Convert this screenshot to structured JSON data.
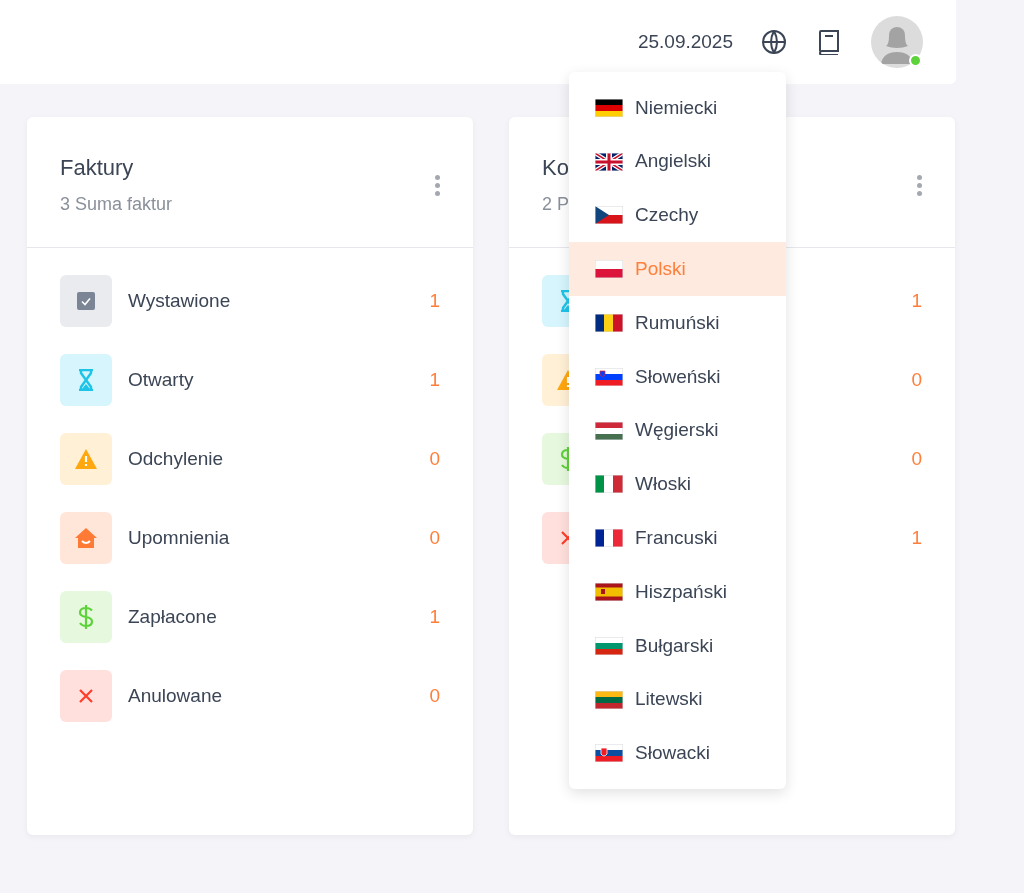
{
  "header": {
    "date": "25.09.2025",
    "user_online": true
  },
  "cards": [
    {
      "title": "Faktury",
      "subtitle": "3 Suma faktur",
      "rows": [
        {
          "kind": "issued",
          "label": "Wystawione",
          "count": "1"
        },
        {
          "kind": "open",
          "label": "Otwarty",
          "count": "1"
        },
        {
          "kind": "deviation",
          "label": "Odchylenie",
          "count": "0"
        },
        {
          "kind": "reminder",
          "label": "Upomnienia",
          "count": "0"
        },
        {
          "kind": "paid",
          "label": "Zapłacone",
          "count": "1"
        },
        {
          "kind": "cancelled",
          "label": "Anulowane",
          "count": "0"
        }
      ]
    },
    {
      "title": "Ko",
      "subtitle": "2 P",
      "rows": [
        {
          "kind": "open",
          "count": "1"
        },
        {
          "kind": "deviation",
          "count": "0"
        },
        {
          "kind": "paid",
          "count": "0"
        },
        {
          "kind": "cancelled",
          "count": "1"
        }
      ]
    }
  ],
  "language_menu": [
    {
      "kind": "de",
      "label": "Niemiecki",
      "selected": false
    },
    {
      "kind": "gb",
      "label": "Angielski",
      "selected": false
    },
    {
      "kind": "cz",
      "label": "Czechy",
      "selected": false
    },
    {
      "kind": "pl",
      "label": "Polski",
      "selected": true
    },
    {
      "kind": "ro",
      "label": "Rumuński",
      "selected": false
    },
    {
      "kind": "si",
      "label": "Słoweński",
      "selected": false
    },
    {
      "kind": "hu",
      "label": "Węgierski",
      "selected": false
    },
    {
      "kind": "it",
      "label": "Włoski",
      "selected": false
    },
    {
      "kind": "fr",
      "label": "Francuski",
      "selected": false
    },
    {
      "kind": "es",
      "label": "Hiszpański",
      "selected": false
    },
    {
      "kind": "bg",
      "label": "Bułgarski",
      "selected": false
    },
    {
      "kind": "lt",
      "label": "Litewski",
      "selected": false
    },
    {
      "kind": "sk",
      "label": "Słowacki",
      "selected": false
    }
  ]
}
